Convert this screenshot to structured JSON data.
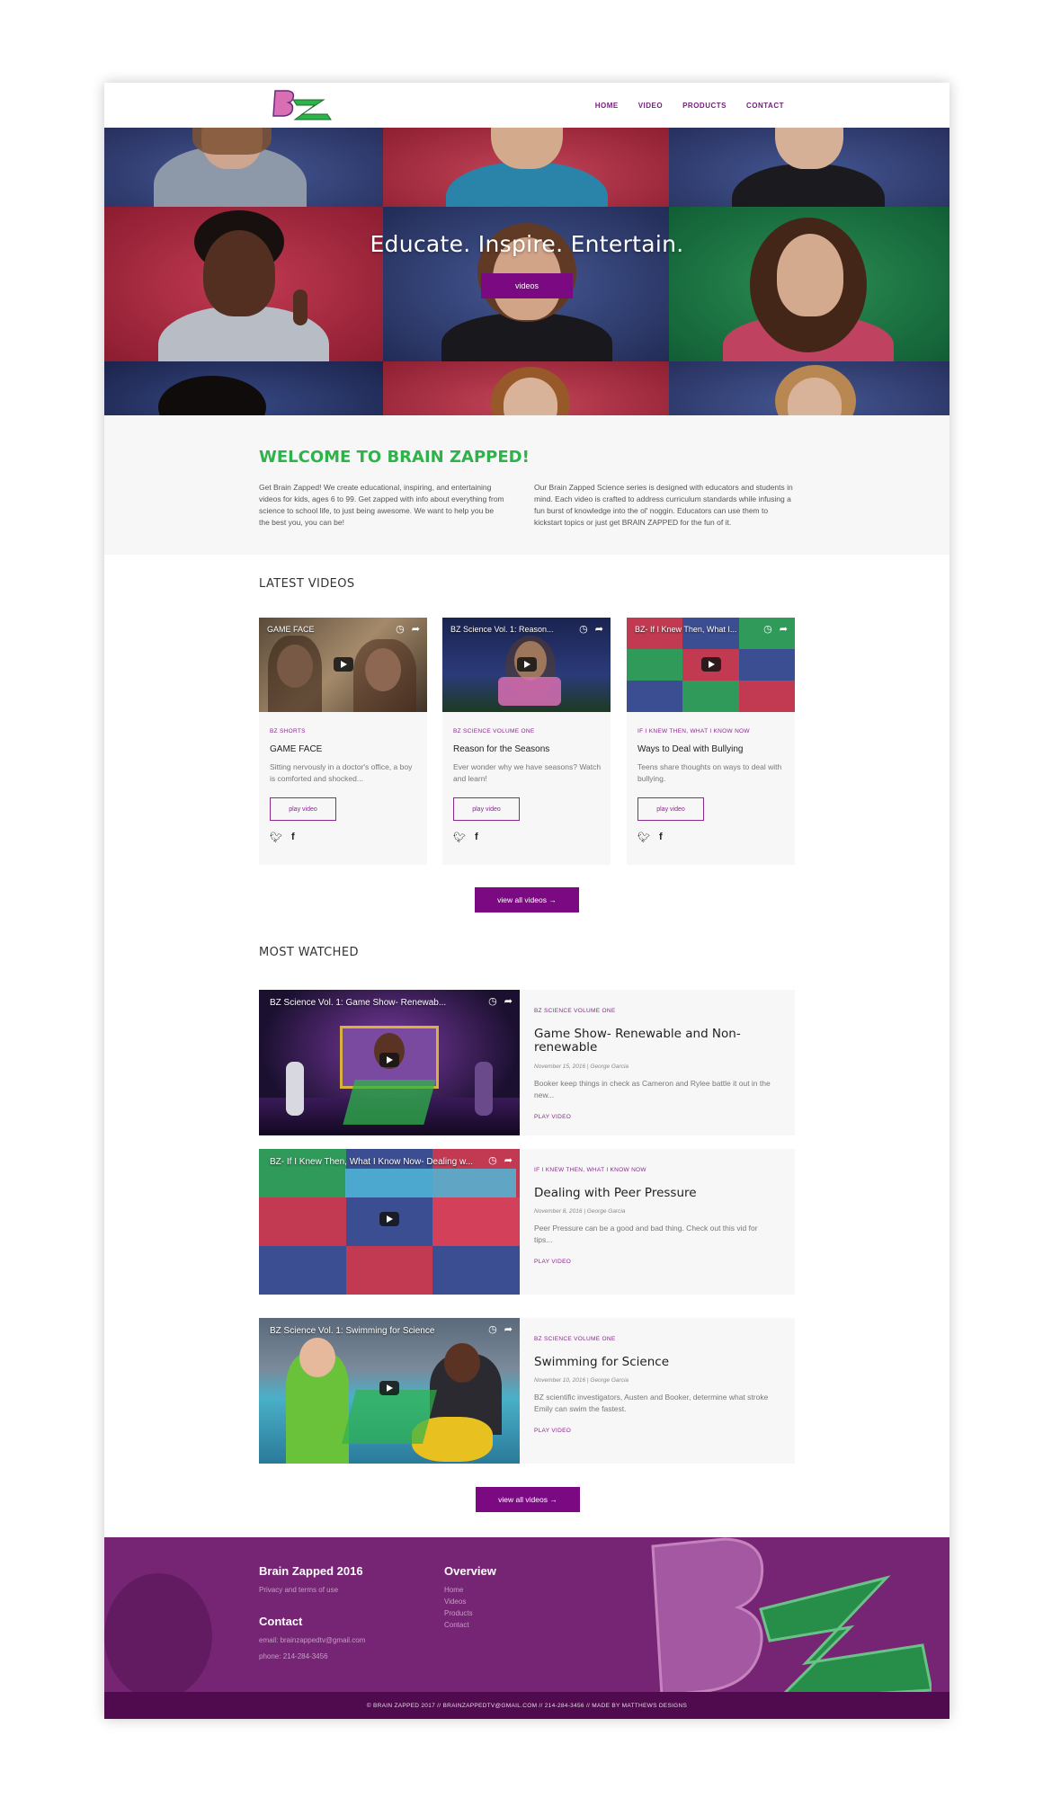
{
  "header": {
    "logo_text": "BZ",
    "nav": [
      "HOME",
      "VIDEO",
      "PRODUCTS",
      "CONTACT"
    ]
  },
  "hero": {
    "title": "Educate. Inspire. Entertain.",
    "button": "videos"
  },
  "welcome": {
    "title": "WELCOME TO BRAIN ZAPPED!",
    "col1": "Get Brain Zapped! We create educational, inspiring, and entertaining videos for kids, ages 6 to 99. Get zapped with info about everything from science to school life, to just being awesome. We want to help you be the best you, you can be!",
    "col2": "Our Brain Zapped Science series is designed with educators and students in mind. Each video is crafted to address curriculum standards while infusing a fun burst of knowledge into the ol' noggin. Educators can use them to kickstart topics or just get BRAIN ZAPPED for the fun of it."
  },
  "latest": {
    "heading": "LATEST VIDEOS",
    "cards": [
      {
        "thumb_title": "GAME FACE",
        "category": "BZ SHORTS",
        "title": "GAME FACE",
        "desc": "Sitting nervously in a doctor's office, a boy is comforted and shocked...",
        "button": "play video"
      },
      {
        "thumb_title": "BZ Science Vol. 1: Reason...",
        "category": "BZ SCIENCE VOLUME ONE",
        "title": "Reason for the Seasons",
        "desc": "Ever wonder why we have seasons? Watch and learn!",
        "button": "play video"
      },
      {
        "thumb_title": "BZ- If I Knew Then, What I...",
        "category": "IF I KNEW THEN, WHAT I KNOW NOW",
        "title": "Ways to Deal with Bullying",
        "desc": "Teens share thoughts on ways to deal with bullying.",
        "button": "play video"
      }
    ],
    "cta": "view all videos →"
  },
  "most_watched": {
    "heading": "MOST WATCHED",
    "items": [
      {
        "thumb_title": "BZ Science Vol. 1: Game Show- Renewab...",
        "category": "BZ SCIENCE VOLUME ONE",
        "title": "Game Show- Renewable and Non-renewable",
        "meta": "November 15, 2016 | George Garcia",
        "desc": "Booker keep things in check as Cameron and Rylee battle it out in the new...",
        "link": "PLAY VIDEO"
      },
      {
        "thumb_title": "BZ- If I Knew Then, What I Know Now- Dealing w...",
        "category": "IF I KNEW THEN, WHAT I KNOW NOW",
        "title": "Dealing with Peer Pressure",
        "meta": "November 8, 2016 | George Garcia",
        "desc": "Peer Pressure can be a good and bad thing. Check out this vid for tips...",
        "link": "PLAY VIDEO"
      },
      {
        "thumb_title": "BZ Science Vol. 1: Swimming for Science",
        "category": "BZ SCIENCE VOLUME ONE",
        "title": "Swimming for Science",
        "meta": "November 10, 2016 | George Garcia",
        "desc": "BZ scientific investigators, Austen and Booker, determine what stroke Emily can swim the fastest.",
        "link": "PLAY VIDEO"
      }
    ],
    "cta": "view all videos →"
  },
  "footer": {
    "brand": "Brain Zapped 2016",
    "privacy": "Privacy and terms of use",
    "contact_title": "Contact",
    "email": "email: brainzappedtv@gmail.com",
    "phone": "phone: 214-284-3456",
    "overview_title": "Overview",
    "links": [
      "Home",
      "Videos",
      "Products",
      "Contact"
    ],
    "copyright": "© BRAIN ZAPPED 2017 // BRAINZAPPEDTV@GMAIL.COM // 214-284-3456 // MADE BY MATTHEWS DESIGNS"
  },
  "colors": {
    "accent": "#7b0a82",
    "green": "#2db34a",
    "footer": "#762575"
  }
}
